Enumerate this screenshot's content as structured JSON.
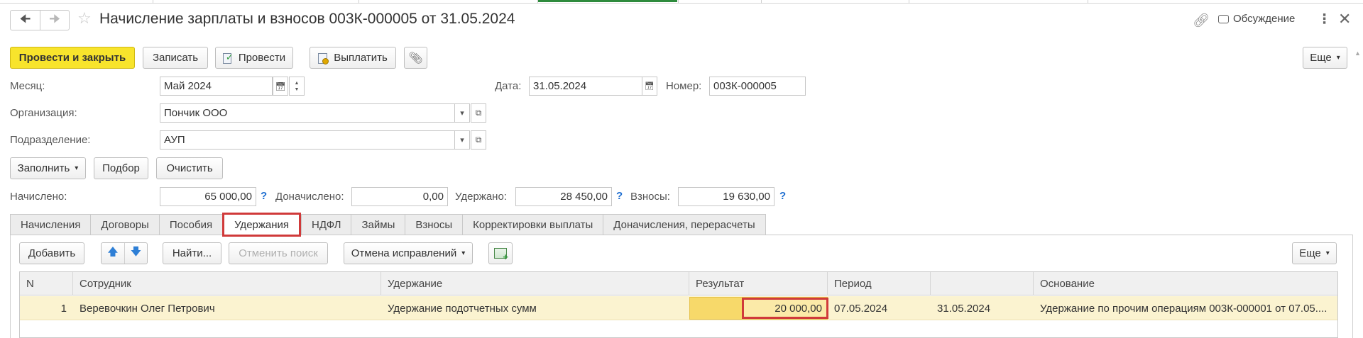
{
  "header": {
    "title": "Начисление зарплаты и взносов 003К-000005 от 31.05.2024",
    "back_icon": "arrow-left-icon",
    "forward_icon": "arrow-right-icon",
    "favorite_icon": "star-icon",
    "link_icon": "link-icon",
    "discussion_label": "Обсуждение",
    "more_icon": "more-vert-icon",
    "close_icon": "close-icon"
  },
  "toolbar": {
    "post_close_label": "Провести и закрыть",
    "save_label": "Записать",
    "post_label": "Провести",
    "pay_label": "Выплатить",
    "attach_icon": "paperclip-icon",
    "more_label": "Еще"
  },
  "form": {
    "month_label": "Месяц:",
    "month_value": "Май 2024",
    "date_label": "Дата:",
    "date_value": "31.05.2024",
    "number_label": "Номер:",
    "number_value": "003К-000005",
    "org_label": "Организация:",
    "org_value": "Пончик ООО",
    "dept_label": "Подразделение:",
    "dept_value": "АУП"
  },
  "actions": {
    "fill_label": "Заполнить",
    "pick_label": "Подбор",
    "clear_label": "Очистить"
  },
  "totals": {
    "accrued_label": "Начислено:",
    "accrued_value": "65 000,00",
    "extra_label": "Доначислено:",
    "extra_value": "0,00",
    "withheld_label": "Удержано:",
    "withheld_value": "28 450,00",
    "contrib_label": "Взносы:",
    "contrib_value": "19 630,00",
    "help": "?"
  },
  "tabs": [
    {
      "label": "Начисления"
    },
    {
      "label": "Договоры"
    },
    {
      "label": "Пособия"
    },
    {
      "label": "Удержания"
    },
    {
      "label": "НДФЛ"
    },
    {
      "label": "Займы"
    },
    {
      "label": "Взносы"
    },
    {
      "label": "Корректировки выплаты"
    },
    {
      "label": "Доначисления, перерасчеты"
    }
  ],
  "table_toolbar": {
    "add_label": "Добавить",
    "find_label": "Найти...",
    "cancel_search_label": "Отменить поиск",
    "undo_fix_label": "Отмена исправлений",
    "more_label": "Еще"
  },
  "table": {
    "columns": [
      "N",
      "Сотрудник",
      "Удержание",
      "Результат",
      "Период",
      "",
      "Основание"
    ],
    "rows": [
      {
        "n": "1",
        "employee": "Веревочкин Олег Петрович",
        "deduction": "Удержание подотчетных сумм",
        "result": "20 000,00",
        "period_from": "07.05.2024",
        "period_to": "31.05.2024",
        "basis": "Удержание по прочим операциям 003К-000001 от 07.05...."
      }
    ]
  }
}
